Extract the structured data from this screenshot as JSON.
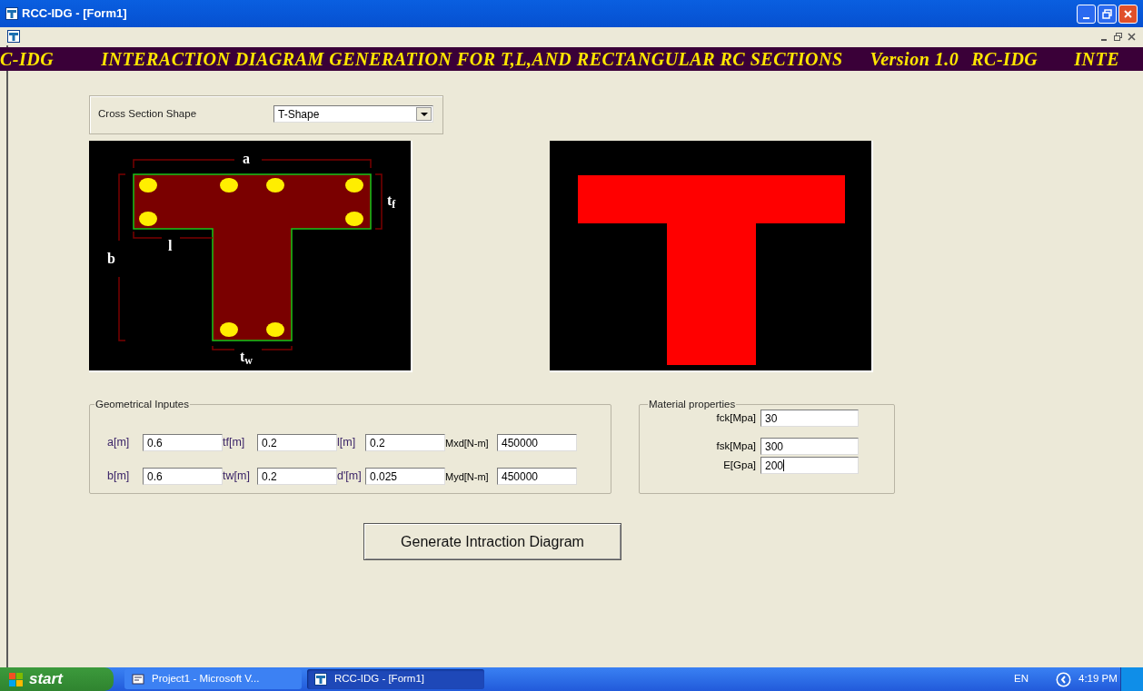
{
  "window": {
    "title": "RCC-IDG - [Form1]"
  },
  "marquee": [
    "C-IDG",
    "INTERACTION DIAGRAM GENERATION FOR  T,L,AND RECTANGULAR RC SECTIONS",
    "Version 1.0",
    "RC-IDG",
    "INTE"
  ],
  "cross_section": {
    "label": "Cross Section Shape",
    "value": "T-Shape"
  },
  "diagram_labels": [
    "a",
    "t$_{f}$",
    "l",
    "b",
    "t$_{w}$"
  ],
  "geometrical_inputs": {
    "title": "Geometrical Inputes",
    "fields": [
      {
        "label": "a[m]",
        "value": "0.6"
      },
      {
        "label": "tf[m]",
        "value": "0.2"
      },
      {
        "label": "l[m]",
        "value": "0.2"
      },
      {
        "label": "Mxd[N-m]",
        "value": "450000"
      },
      {
        "label": "b[m]",
        "value": "0.6"
      },
      {
        "label": "tw[m]",
        "value": "0.2"
      },
      {
        "label": "d'[m]",
        "value": "0.025"
      },
      {
        "label": "Myd[N-m]",
        "value": "450000"
      }
    ]
  },
  "material_properties": {
    "title": "Material properties",
    "fields": [
      {
        "label": "fck[Mpa]",
        "value": "30",
        "focused": false
      },
      {
        "label": "fsk[Mpa]",
        "value": "300",
        "focused": false
      },
      {
        "label": "E[Gpa]",
        "value": "200",
        "focused": true
      }
    ]
  },
  "generate_button": "Generate  Intraction Diagram",
  "taskbar": {
    "start": "start",
    "tasks": [
      {
        "label": "Project1 - Microsoft V...",
        "selected": false
      },
      {
        "label": "RCC-IDG - [Form1]",
        "selected": true
      }
    ],
    "language": "EN",
    "clock": "4:19 PM"
  }
}
